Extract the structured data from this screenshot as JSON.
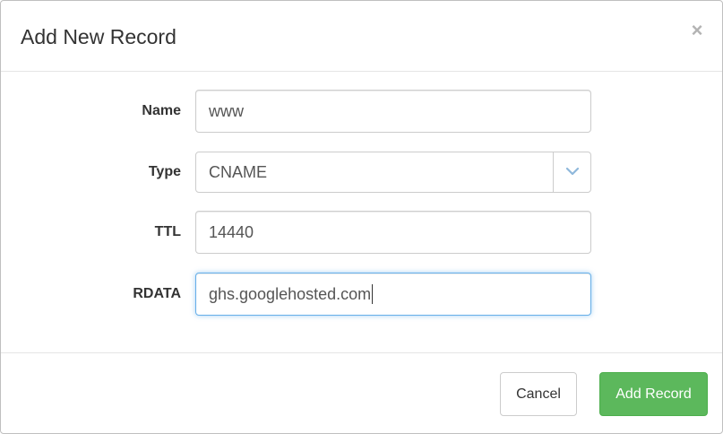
{
  "modal": {
    "title": "Add New Record",
    "close_label": "×"
  },
  "form": {
    "name": {
      "label": "Name",
      "value": "www"
    },
    "type": {
      "label": "Type",
      "value": "CNAME",
      "options": [
        "CNAME"
      ]
    },
    "ttl": {
      "label": "TTL",
      "value": "14440"
    },
    "rdata": {
      "label": "RDATA",
      "value": "ghs.googlehosted.com"
    }
  },
  "footer": {
    "cancel_label": "Cancel",
    "submit_label": "Add Record"
  },
  "colors": {
    "success": "#5cb85c",
    "focus_border": "#66afe9",
    "caret": "#8fb8db"
  },
  "icons": {
    "close": "close-icon",
    "select_caret": "chevron-down-icon"
  }
}
